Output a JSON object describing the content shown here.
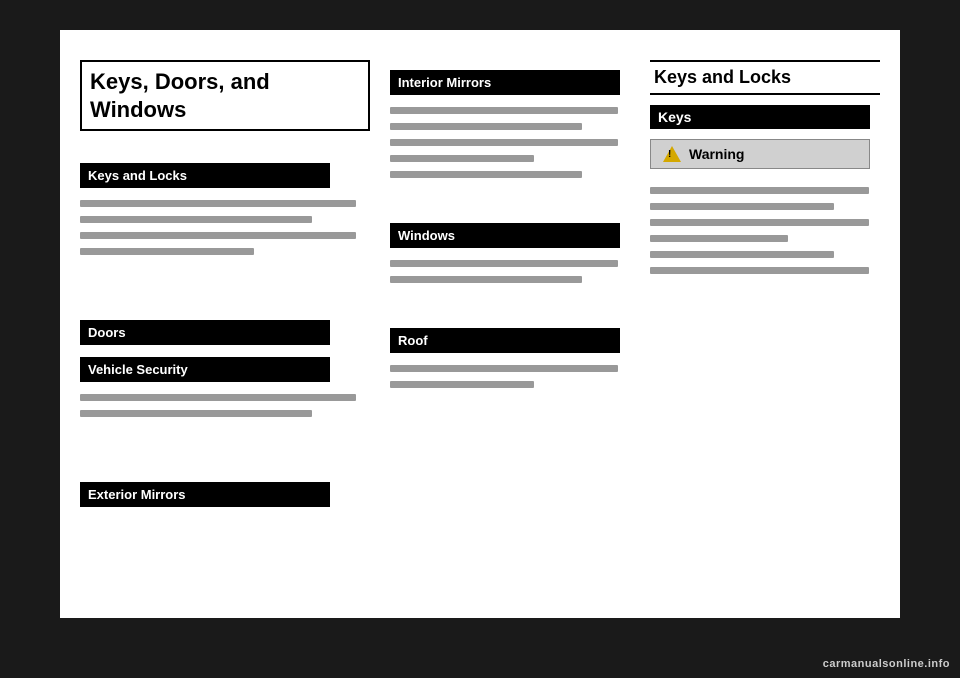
{
  "page": {
    "background": "#1a1a1a"
  },
  "left_column": {
    "main_title": "Keys, Doors, and Windows",
    "keys_locks_label": "Keys and Locks",
    "doors_label": "Doors",
    "vehicle_security_label": "Vehicle Security",
    "exterior_mirrors_label": "Exterior Mirrors"
  },
  "middle_column": {
    "interior_mirrors_label": "Interior Mirrors",
    "windows_label": "Windows",
    "roof_label": "Roof"
  },
  "right_column": {
    "main_title": "Keys and Locks",
    "keys_sub_label": "Keys",
    "warning_label": "Warning"
  },
  "watermark": {
    "text": "carmanualsonline.info"
  }
}
